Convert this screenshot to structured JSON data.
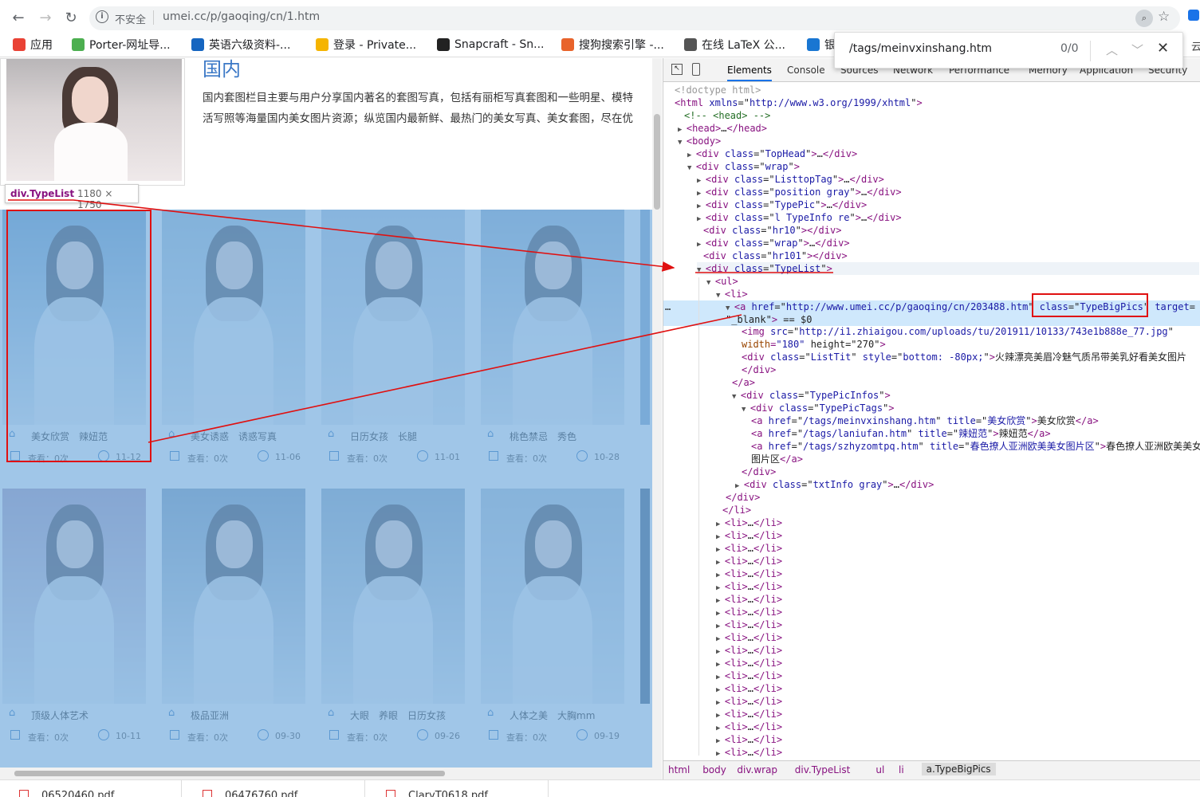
{
  "browser": {
    "insecure_label": "不安全",
    "url": "umei.cc/p/gaoqing/cn/1.htm",
    "bookmarks": [
      {
        "label": "应用",
        "icon": "apps-grid-icon",
        "color": "#e94235"
      },
      {
        "label": "Porter-网址导...",
        "icon": "porter-icon",
        "color": "#4caf50"
      },
      {
        "label": "英语六级资料-...",
        "icon": "book-icon",
        "color": "#1565c0"
      },
      {
        "label": "登录 - Private...",
        "icon": "key-icon",
        "color": "#f5b400"
      },
      {
        "label": "Snapcraft - Sn...",
        "icon": "snapcraft-icon",
        "color": "#222222"
      },
      {
        "label": "搜狗搜索引擎 -...",
        "icon": "sogou-icon",
        "color": "#e8632b"
      },
      {
        "label": "在线 LaTeX 公...",
        "icon": "latex-icon",
        "color": "#555555"
      },
      {
        "label": "银",
        "icon": "bank-icon",
        "color": "#1976d2"
      }
    ]
  },
  "findbar": {
    "query": "/tags/meinvxinshang.htm",
    "count": "0/0"
  },
  "page": {
    "heading": "国内",
    "intro_line1": "国内套图栏目主要与用户分享国内著名的套图写真，包括有丽柜写真套图和一些明星、模特",
    "intro_line2": "活写照等海量国内美女图片资源；纵览国内最新鲜、最热门的美女写真、美女套图，尽在优",
    "inspect_tooltip": {
      "selector": "div.TypeList",
      "size": "1180 × 1750"
    },
    "cards": [
      {
        "tags": "美女欣赏　辣妞范",
        "views": "查看：0次",
        "date": "11-12",
        "tone": "#7fa8cc"
      },
      {
        "tags": "美女诱惑　诱惑写真",
        "views": "查看：0次",
        "date": "11-06",
        "tone": "#a9c4d8"
      },
      {
        "tags": "日历女孩　长腿",
        "views": "查看：0次",
        "date": "11-01",
        "tone": "#b9cde0"
      },
      {
        "tags": "桃色禁忌　秀色",
        "views": "查看：0次",
        "date": "10-28",
        "tone": "#9dbad4"
      },
      {
        "tags": "顶级人体艺术",
        "views": "查看：0次",
        "date": "10-11",
        "tone": "#b4a2be"
      },
      {
        "tags": "极品亚洲",
        "views": "查看：0次",
        "date": "09-30",
        "tone": "#8ea6bf"
      },
      {
        "tags": "大眼　养眼　日历女孩",
        "views": "查看：0次",
        "date": "09-26",
        "tone": "#9db4c8"
      },
      {
        "tags": "人体之美　大胸mm",
        "views": "查看：0次",
        "date": "09-19",
        "tone": "#b6c8d8"
      }
    ]
  },
  "devtools": {
    "tabs": [
      "Elements",
      "Console",
      "Sources",
      "Network",
      "Performance",
      "Memory",
      "Application",
      "Security"
    ],
    "active_tab": "Elements",
    "lines": [
      "<!doctype html>",
      "<html xmlns=\"http://www.w3.org/1999/xhtml\">",
      "<!-- <head> -->",
      "<head>…</head>",
      "<body>",
      "<div class=\"TopHead\">…</div>",
      "<div class=\"wrap\">",
      "<div class=\"ListtopTag\">…</div>",
      "<div class=\"position gray\">…</div>",
      "<div class=\"TypePic\">…</div>",
      "<div class=\"l TypeInfo re\">…</div>",
      "<div class=\"hr10\"></div>",
      "<div class=\"wrap\">…</div>",
      "<div class=\"hr101\"></div>",
      "<div class=\"TypeList\">",
      "<ul>",
      "<li>",
      "<a href=\"http://www.umei.cc/p/gaoqing/cn/203488.htm\" class=\"TypeBigPics\" target=",
      "\"_blank\"> == $0",
      "<img src=\"http://i1.zhiaigou.com/uploads/tu/201911/10133/743e1b888e_77.jpg\"",
      "width=\"180\" height=\"270\">",
      "<div class=\"ListTit\" style=\"bottom: -80px;\">火辣漂亮美眉冷魅气质吊带美乳好看美女图片",
      "</div>",
      "</a>",
      "<div class=\"TypePicInfos\">",
      "<div class=\"TypePicTags\">",
      "<a href=\"/tags/meinvxinshang.htm\" title=\"美女欣赏\">美女欣赏</a>",
      "<a href=\"/tags/laniufan.htm\" title=\"辣妞范\">辣妞范</a>",
      "<a href=\"/tags/szhyzomtpq.htm\" title=\"春色撩人亚洲欧美美女图片区\">春色撩人亚洲欧美美女",
      "图片区</a>",
      "</div>",
      "<div class=\"txtInfo gray\">…</div>",
      "</div>",
      "</li>"
    ],
    "collapsed_li": "<li>…</li>",
    "breadcrumbs": [
      "html",
      "body",
      "div.wrap",
      "div.TypeList",
      "ul",
      "li",
      "a.TypeBigPics"
    ]
  },
  "downloads": [
    "06520460.pdf",
    "06476760.pdf",
    "ClaryT0618.pdf"
  ]
}
